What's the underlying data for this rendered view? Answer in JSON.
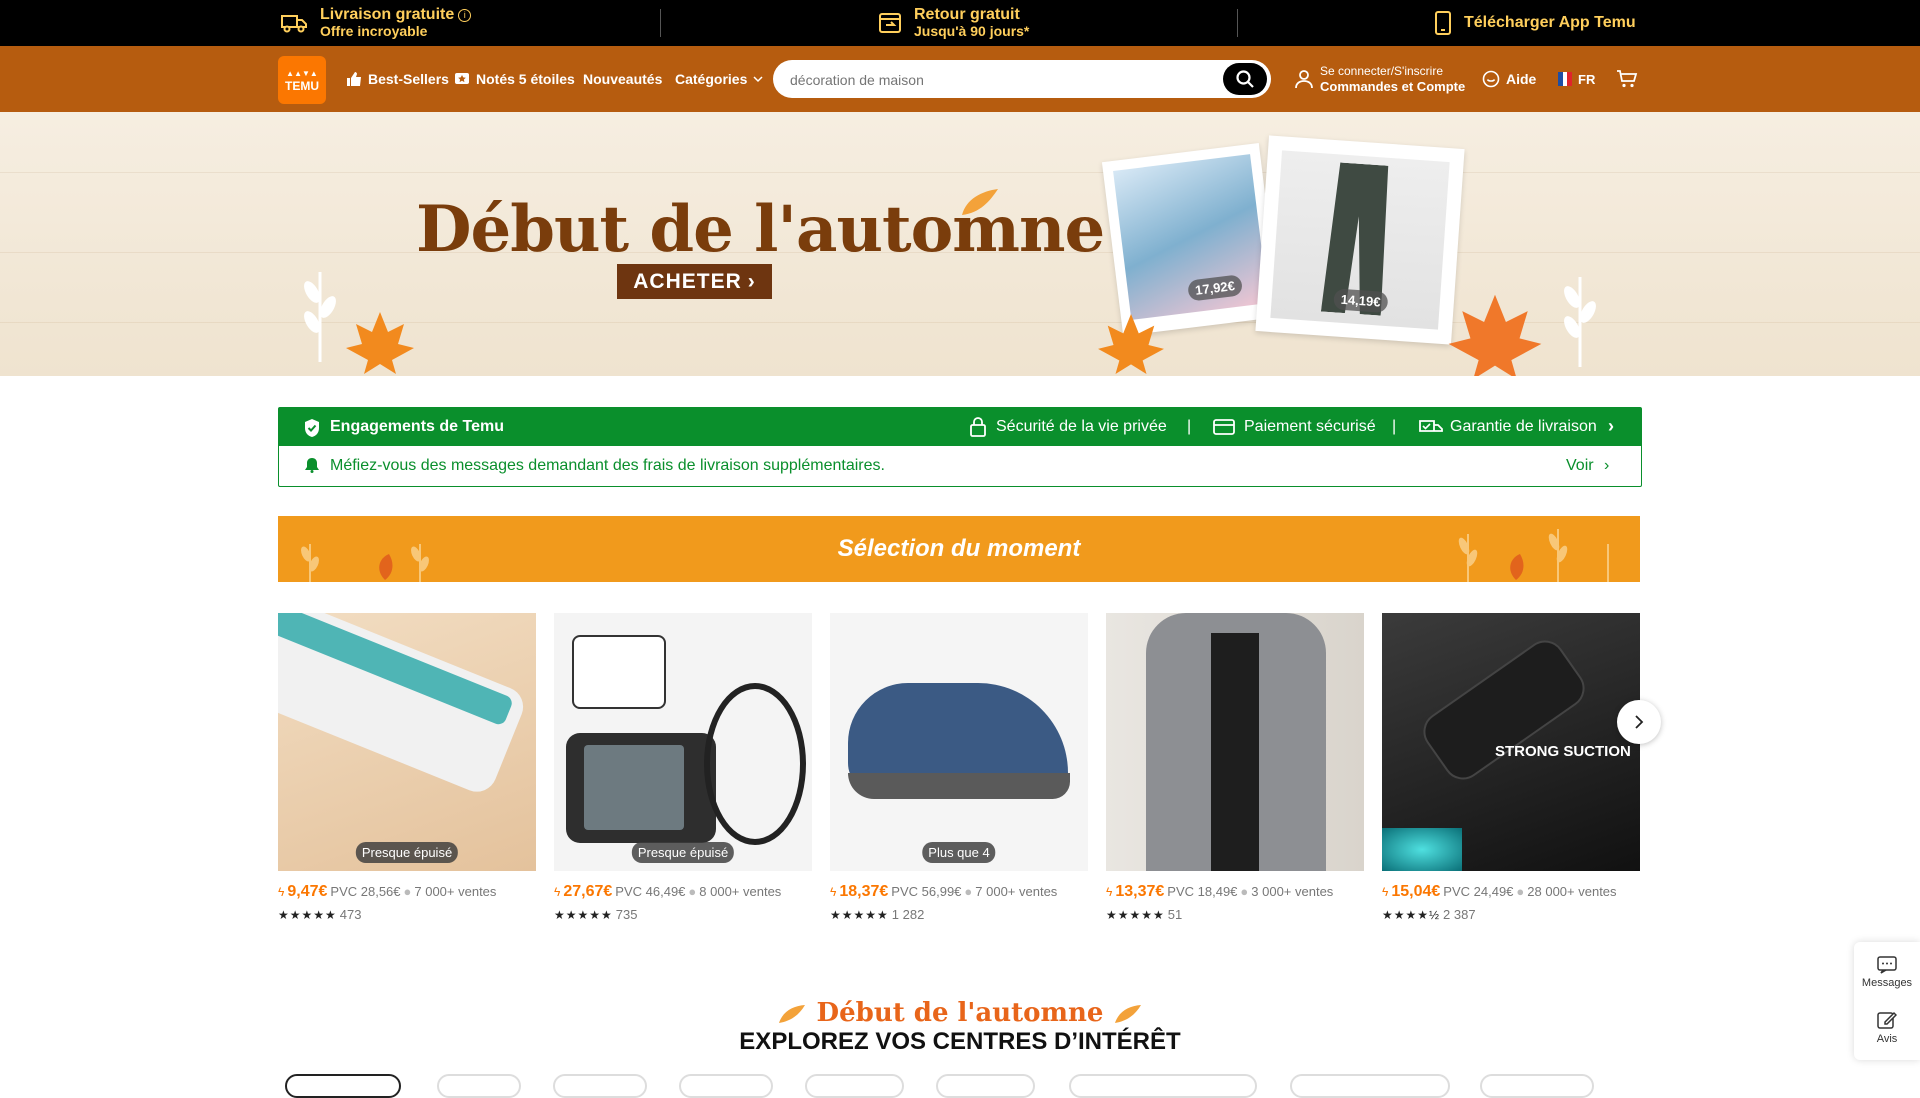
{
  "topbar": {
    "shipping_title": "Livraison gratuite",
    "shipping_sub": "Offre incroyable",
    "return_title": "Retour gratuit",
    "return_sub": "Jusqu'à 90 jours*",
    "app_title": "Télécharger App Temu"
  },
  "header": {
    "logo_top": "▲▲▼▲",
    "logo_text": "TEMU",
    "nav": {
      "bestsellers": "Best-Sellers",
      "five_stars": "Notés 5 étoiles",
      "new": "Nouveautés",
      "categories": "Catégories"
    },
    "search_placeholder": "décoration de maison",
    "account_line1": "Se connecter/S'inscrire",
    "account_line2": "Commandes et Compte",
    "help": "Aide",
    "lang": "FR"
  },
  "banner": {
    "title": "Début de l'automne",
    "cta": "ACHETER",
    "price1": "17,92€",
    "price2": "14,19€"
  },
  "commitments": {
    "title": "Engagements de Temu",
    "privacy": "Sécurité de la vie privée",
    "payment": "Paiement sécurisé",
    "delivery": "Garantie de livraison",
    "warning": "Méfiez-vous des messages demandant des frais de livraison supplémentaires.",
    "see": "Voir"
  },
  "selection": {
    "title": "Sélection du moment",
    "products": [
      {
        "badge": "Presque épuisé",
        "price": "9,47€",
        "pvc": "PVC 28,56€",
        "sales": "7 000+ ventes",
        "stars": "★★★★★",
        "reviews": "473"
      },
      {
        "badge": "Presque épuisé",
        "price": "27,67€",
        "pvc": "PVC 46,49€",
        "sales": "8 000+ ventes",
        "stars": "★★★★★",
        "reviews": "735"
      },
      {
        "badge": "Plus que 4",
        "price": "18,37€",
        "pvc": "PVC 56,99€",
        "sales": "7 000+ ventes",
        "stars": "★★★★★",
        "reviews": "1 282"
      },
      {
        "badge": "",
        "price": "13,37€",
        "pvc": "PVC 18,49€",
        "sales": "3 000+ ventes",
        "stars": "★★★★★",
        "reviews": "51"
      },
      {
        "badge": "",
        "price": "15,04€",
        "pvc": "PVC 24,49€",
        "sales": "28 000+ ventes",
        "stars": "★★★★½",
        "reviews": "2 387",
        "overlay": "STRONG SUCTION"
      }
    ]
  },
  "side_panel": {
    "messages": "Messages",
    "reviews": "Avis"
  },
  "explore": {
    "subtitle": "Début de l'automne",
    "title": "EXPLOREZ VOS CENTRES D’INTÉRÊT"
  },
  "colors": {
    "header_bg": "#b65c0f",
    "accent_orange": "#fb7701",
    "commit_green": "#0a8f2c",
    "selection_bg": "#f19a1c"
  }
}
